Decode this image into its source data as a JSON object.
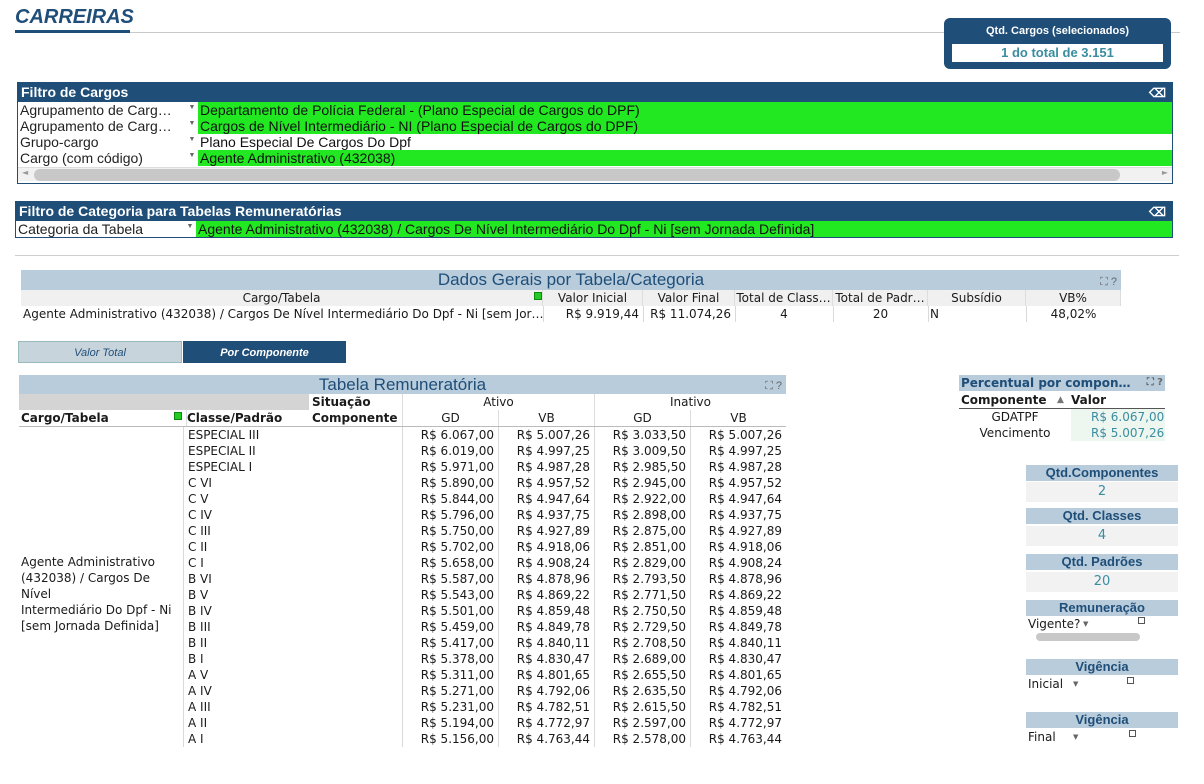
{
  "header": {
    "title": "CARREIRAS",
    "qtd_label": "Qtd. Cargos (selecionados)",
    "qtd_value": "1 do total de 3.151"
  },
  "filtro_cargos": {
    "title": "Filtro de Cargos",
    "rows": [
      {
        "label": "Agrupamento de Carg…",
        "value": "Departamento de Polícia Federal - (Plano Especial de Cargos do DPF)",
        "selected": true
      },
      {
        "label": "Agrupamento de Carg…",
        "value": "Cargos de Nível Intermediário - NI (Plano Especial de Cargos do DPF)",
        "selected": true
      },
      {
        "label": "Grupo-cargo",
        "value": "Plano Especial De Cargos Do Dpf",
        "selected": false
      },
      {
        "label": "Cargo (com código)",
        "value": "Agente Administrativo  (432038)",
        "selected": true
      }
    ]
  },
  "filtro_categoria": {
    "title": "Filtro de Categoria para Tabelas Remuneratórias",
    "label": "Categoria da Tabela",
    "value": "Agente Administrativo  (432038) / Cargos De Nível Intermediário Do Dpf - Ni [sem Jornada Definida]"
  },
  "dados_gerais": {
    "title": "Dados Gerais por Tabela/Categoria",
    "columns": [
      "Cargo/Tabela",
      "Valor Inicial",
      "Valor Final",
      "Total de Class…",
      "Total de Padr…",
      "Subsídio",
      "VB%"
    ],
    "row": [
      "Agente Administrativo  (432038) / Cargos De Nível Intermediário Do Dpf - Ni [sem Jor…",
      "R$ 9.919,44",
      "R$ 11.074,26",
      "4",
      "20",
      "N",
      "48,02%"
    ]
  },
  "tabs": {
    "valor_total": "Valor Total",
    "por_componente": "Por Componente"
  },
  "tabela": {
    "title": "Tabela Remuneratória",
    "situacao_label": "Situação",
    "componente_label": "Componente",
    "cargo_header": "Cargo/Tabela",
    "classe_header": "Classe/Padrão",
    "ativo": "Ativo",
    "inativo": "Inativo",
    "gd": "GD",
    "vb": "VB",
    "cargo_text": [
      "Agente Administrativo",
      "(432038) / Cargos De Nível",
      "Intermediário Do Dpf - Ni",
      "[sem Jornada Definida]"
    ],
    "rows": [
      [
        "ESPECIAL III",
        "R$ 6.067,00",
        "R$ 5.007,26",
        "R$ 3.033,50",
        "R$ 5.007,26"
      ],
      [
        "ESPECIAL II",
        "R$ 6.019,00",
        "R$ 4.997,25",
        "R$ 3.009,50",
        "R$ 4.997,25"
      ],
      [
        "ESPECIAL I",
        "R$ 5.971,00",
        "R$ 4.987,28",
        "R$ 2.985,50",
        "R$ 4.987,28"
      ],
      [
        "C VI",
        "R$ 5.890,00",
        "R$ 4.957,52",
        "R$ 2.945,00",
        "R$ 4.957,52"
      ],
      [
        "C V",
        "R$ 5.844,00",
        "R$ 4.947,64",
        "R$ 2.922,00",
        "R$ 4.947,64"
      ],
      [
        "C IV",
        "R$ 5.796,00",
        "R$ 4.937,75",
        "R$ 2.898,00",
        "R$ 4.937,75"
      ],
      [
        "C III",
        "R$ 5.750,00",
        "R$ 4.927,89",
        "R$ 2.875,00",
        "R$ 4.927,89"
      ],
      [
        "C II",
        "R$ 5.702,00",
        "R$ 4.918,06",
        "R$ 2.851,00",
        "R$ 4.918,06"
      ],
      [
        "C I",
        "R$ 5.658,00",
        "R$ 4.908,24",
        "R$ 2.829,00",
        "R$ 4.908,24"
      ],
      [
        "B VI",
        "R$ 5.587,00",
        "R$ 4.878,96",
        "R$ 2.793,50",
        "R$ 4.878,96"
      ],
      [
        "B V",
        "R$ 5.543,00",
        "R$ 4.869,22",
        "R$ 2.771,50",
        "R$ 4.869,22"
      ],
      [
        "B IV",
        "R$ 5.501,00",
        "R$ 4.859,48",
        "R$ 2.750,50",
        "R$ 4.859,48"
      ],
      [
        "B III",
        "R$ 5.459,00",
        "R$ 4.849,78",
        "R$ 2.729,50",
        "R$ 4.849,78"
      ],
      [
        "B II",
        "R$ 5.417,00",
        "R$ 4.840,11",
        "R$ 2.708,50",
        "R$ 4.840,11"
      ],
      [
        "B I",
        "R$ 5.378,00",
        "R$ 4.830,47",
        "R$ 2.689,00",
        "R$ 4.830,47"
      ],
      [
        "A V",
        "R$ 5.311,00",
        "R$ 4.801,65",
        "R$ 2.655,50",
        "R$ 4.801,65"
      ],
      [
        "A IV",
        "R$ 5.271,00",
        "R$ 4.792,06",
        "R$ 2.635,50",
        "R$ 4.792,06"
      ],
      [
        "A III",
        "R$ 5.231,00",
        "R$ 4.782,51",
        "R$ 2.615,50",
        "R$ 4.782,51"
      ],
      [
        "A II",
        "R$ 5.194,00",
        "R$ 4.772,97",
        "R$ 2.597,00",
        "R$ 4.772,97"
      ],
      [
        "A I",
        "R$ 5.156,00",
        "R$ 4.763,44",
        "R$ 2.578,00",
        "R$ 4.763,44"
      ]
    ]
  },
  "percentual": {
    "title": "Percentual por compon…",
    "col_componente": "Componente",
    "col_valor": "Valor",
    "rows": [
      [
        "GDATPF",
        "R$ 6.067,00"
      ],
      [
        "Vencimento",
        "R$ 5.007,26"
      ]
    ]
  },
  "widgets": {
    "qtd_componentes_label": "Qtd.Componentes",
    "qtd_componentes_value": "2",
    "qtd_classes_label": "Qtd. Classes",
    "qtd_classes_value": "4",
    "qtd_padroes_label": "Qtd. Padrões",
    "qtd_padroes_value": "20",
    "remuneracao_label": "Remuneração",
    "remuneracao_field": "Vigente?",
    "vigencia_inicial_label": "Vigência",
    "vigencia_inicial_field": "Inicial",
    "vigencia_final_label": "Vigência",
    "vigencia_final_field": "Final"
  },
  "colors": {
    "brand": "#1f4e79",
    "selected_green": "#22e822",
    "box_header": "#b8ccdb",
    "value_teal": "#3a8da0"
  }
}
